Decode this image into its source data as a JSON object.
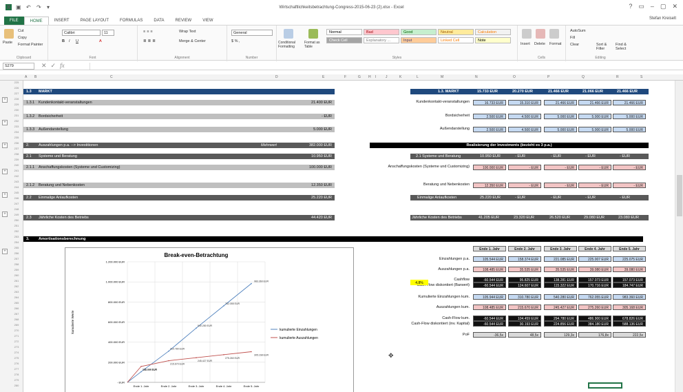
{
  "window": {
    "title": "Wirtschaftlichkeitsbetrachtung-Congress-2015-06-23 (2).xlsx - Excel",
    "user": "Stefan Kreiselt",
    "controls": [
      "?",
      "▭",
      "–",
      "▢",
      "✕"
    ]
  },
  "tabs": [
    "FILE",
    "HOME",
    "INSERT",
    "PAGE LAYOUT",
    "FORMULAS",
    "DATA",
    "REVIEW",
    "VIEW"
  ],
  "ribbon": {
    "clipboard": {
      "paste": "Paste",
      "cut": "Cut",
      "copy": "Copy",
      "painter": "Format Painter",
      "label": "Clipboard"
    },
    "font": {
      "name": "Calibri",
      "size": "11",
      "label": "Font"
    },
    "alignment": {
      "wrap": "Wrap Text",
      "merge": "Merge & Center",
      "label": "Alignment"
    },
    "number": {
      "format": "General",
      "label": "Number"
    },
    "styles": {
      "conditional": "Conditional Formatting",
      "table": "Format as Table",
      "items": [
        {
          "name": "Normal",
          "bg": "#ffffff",
          "fg": "#000000"
        },
        {
          "name": "Bad",
          "bg": "#ffc7ce",
          "fg": "#9c0006"
        },
        {
          "name": "Good",
          "bg": "#c6efce",
          "fg": "#006100"
        },
        {
          "name": "Neutral",
          "bg": "#ffeb9c",
          "fg": "#9c5700"
        },
        {
          "name": "Calculation",
          "bg": "#f2f2f2",
          "fg": "#fa7d00"
        },
        {
          "name": "Check Cell",
          "bg": "#a5a5a5",
          "fg": "#ffffff"
        },
        {
          "name": "Explanatory ...",
          "bg": "#ffffff",
          "fg": "#7f7f7f"
        },
        {
          "name": "Input",
          "bg": "#ffcc99",
          "fg": "#3f3f76"
        },
        {
          "name": "Linked Cell",
          "bg": "#ffffff",
          "fg": "#fa7d00"
        },
        {
          "name": "Note",
          "bg": "#ffffcc",
          "fg": "#000000"
        }
      ],
      "label": "Styles"
    },
    "cells": {
      "insert": "Insert",
      "delete": "Delete",
      "format": "Format",
      "label": "Cells"
    },
    "editing": {
      "autosum": "AutoSum",
      "fill": "Fill",
      "clear": "Clear",
      "sort": "Sort & Filter",
      "find": "Find & Select",
      "label": "Editing"
    }
  },
  "formula_bar": {
    "name_box": "S279",
    "fx": "fx",
    "value": ""
  },
  "columns": [
    "A",
    "B",
    "C",
    "D",
    "E",
    "F",
    "G",
    "H",
    "I",
    "J",
    "K",
    "L",
    "M",
    "N",
    "O",
    "P",
    "Q",
    "R",
    "S"
  ],
  "left_rows": [
    {
      "num": "1.3",
      "label": "MARKT",
      "value": "",
      "style": "navy"
    },
    {
      "num": "1.3.1",
      "label": "Kundenkontakt-veranstaltungen",
      "value": "21.400 EUR",
      "style": "grey"
    },
    {
      "num": "1.3.2",
      "label": "Bordsicherheit",
      "value": "- EUR",
      "style": "grey"
    },
    {
      "num": "1.3.3",
      "label": "Außendarstellung",
      "value": "5.000 EUR",
      "style": "grey"
    },
    {
      "num": "2.",
      "label": "Auszahlungen p.a. --> Investitionen",
      "value": "382.000 EUR",
      "note": "Mehrwert",
      "style": "dgrey"
    },
    {
      "num": "2.1",
      "label": "Systeme und Beratung",
      "value": "10.950 EUR",
      "style": "dgrey"
    },
    {
      "num": "2.1.1",
      "label": "Anschaffungskosten (Systeme und Customizing)",
      "value": "100.000 EUR",
      "style": "grey"
    },
    {
      "num": "2.1.2",
      "label": "Beratung und Nebenkosten",
      "value": "12.350 EUR",
      "style": "grey"
    },
    {
      "num": "2.2",
      "label": "Einmalige Anlaufkosten",
      "value": "25.220 EUR",
      "style": "dgrey"
    },
    {
      "num": "2.3",
      "label": "Jährliche Kosten des Betriebs",
      "value": "44.420 EUR",
      "style": "dgrey"
    },
    {
      "num": "3.",
      "label": "Amortisationsberechnung",
      "value": "",
      "style": "black"
    }
  ],
  "right_top": {
    "markt": {
      "label": "1.3. MARKT",
      "values": [
        "15.733 EUR",
        "20.270 EUR",
        "21.466 EUR",
        "21.066 EUR",
        "21.466 EUR"
      ]
    },
    "rows": [
      {
        "label": "Kundenkontakt-veranstaltungen",
        "values": [
          "16.733 EUR",
          "15.310 EUR",
          "21.466 EUR",
          "21.466 EUR",
          "21.466 EUR"
        ],
        "color": "blue"
      },
      {
        "label": "Bordsicherheit",
        "values": [
          "2.500 EUR",
          "4.500 EUR",
          "5.000 EUR",
          "5.000 EUR",
          "5.000 EUR"
        ],
        "color": "blue"
      },
      {
        "label": "Außendarstellung",
        "values": [
          "2.500 EUR",
          "4.500 EUR",
          "5.000 EUR",
          "5.000 EUR",
          "5.000 EUR"
        ],
        "color": "blue"
      }
    ],
    "invest_header": "Realisierung der Investments (bezieht es 3 p.a.)",
    "systeme": {
      "label": "2.1 Systeme und Beratung",
      "values": [
        "10.950 EUR",
        "- EUR",
        "- EUR",
        "- EUR",
        "- EUR"
      ]
    },
    "rows2": [
      {
        "label": "Anschaffungskosten (Systeme und Customizing)",
        "values": [
          "100.000 EUR",
          "- EUR",
          "- EUR",
          "- EUR",
          "- EUR"
        ],
        "color": "red"
      },
      {
        "label": "Beratung und Nebenkosten",
        "values": [
          "12.350 EUR",
          "- EUR",
          "- EUR",
          "- EUR",
          "- EUR"
        ],
        "color": "red"
      }
    ],
    "anlauf": {
      "label": "Einmalige Anlaufkosten",
      "values": [
        "25.220 EUR",
        "- EUR",
        "- EUR",
        "- EUR",
        "- EUR"
      ]
    },
    "betrieb": {
      "label": "Jährliche Kosten des Betriebs",
      "values": [
        "41.205 EUR",
        "23.320 EUR",
        "26.520 EUR",
        "29.080 EUR",
        "23.080 EUR"
      ]
    }
  },
  "amort": {
    "headers": [
      "Ende 1. Jahr",
      "Ende 2. Jahr",
      "Ende 3. Jahr",
      "Ende 4. Jahr",
      "Ende 5. Jahr"
    ],
    "rows": [
      {
        "label": "Einzahlungen p.a.",
        "values": [
          "105.544 EUR",
          "158.374 EUR",
          "221.085 EUR",
          "225.007 EUR",
          "225.075 EUR"
        ],
        "color": "blue"
      },
      {
        "label": "Auszahlungen p.a.",
        "values": [
          "108.485 EUR",
          "35.535 EUR",
          "35.535 EUR",
          "39.080 EUR",
          "39.080 EUR"
        ],
        "color": "red"
      },
      {
        "label": "Cashflow",
        "values": [
          "-60.544 EUR",
          "95.825 EUR",
          "138.281 EUR",
          "157.073 EUR",
          "157.073 EUR"
        ],
        "color": "black"
      },
      {
        "label": "Cash Flow diskontiert (Barwert)",
        "values": [
          "-60.544 EUR",
          "124.607 EUR",
          "115.322 EUR",
          "170.716 EUR",
          "184.747 EUR"
        ],
        "color": "black"
      },
      {
        "label": "Kumulierte Einzahlungen kum.",
        "values": [
          "105.944 EUR",
          "310.780 EUR",
          "540.280 EUR",
          "762.055 EUR",
          "983.360 EUR"
        ],
        "color": "blue"
      },
      {
        "label": "Auszahlungen kum.",
        "values": [
          "108.485 EUR",
          "215.670 EUR",
          "245.427 EUR",
          "275.260 EUR",
          "305.168 EUR"
        ],
        "color": "red"
      },
      {
        "label": "Cash-Flow kum.",
        "values": [
          "-60.544 EUR",
          "104.459 EUR",
          "294.780 EUR",
          "486.900 EUR",
          "678.826 EUR"
        ],
        "color": "black"
      },
      {
        "label": "Cash-Flow diskontiert (inv. Kapital)",
        "values": [
          "-60.544 EUR",
          "30.193 EUR",
          "224.856 EUR",
          "384.180 EUR",
          "588.136 EUR"
        ],
        "color": "black"
      },
      {
        "label": "PoF",
        "values": [
          "-36,5x",
          "48,5x",
          "129,3x",
          "176,8x",
          "222,5x"
        ],
        "color": "grey"
      }
    ],
    "rate": "4,8%"
  },
  "chart_data": {
    "type": "line",
    "title": "Break-even-Betrachtung",
    "ylabel": "kumulierte Werte",
    "categories": [
      "Ende 1. Jahr",
      "Ende 2. Jahr",
      "Ende 3. Jahr",
      "Ende 4. Jahr",
      "Ende 5. Jahr"
    ],
    "yticks": [
      "1.200.000 EUR",
      "1.000.000 EUR",
      "800.000 EUR",
      "600.000 EUR",
      "400.000 EUR",
      "200.000 EUR",
      "- EUR"
    ],
    "ylim": [
      0,
      1200000
    ],
    "series": [
      {
        "name": "kumulierte Einzahlungen",
        "color": "#4f81bd",
        "values": [
          105944,
          310780,
          540280,
          762055,
          983360
        ],
        "labels": [
          "105.944 EUR",
          "310.780 EUR",
          "540.280 EUR",
          "762.055 EUR",
          "983.360 EUR"
        ]
      },
      {
        "name": "kumulierte Auszahlungen",
        "color": "#c0504d",
        "values": [
          158485,
          215670,
          245427,
          275260,
          305168
        ],
        "labels": [
          "158.485 EUR",
          "215.670 EUR",
          "245.427 EUR",
          "275.260 EUR",
          "305.168 EUR"
        ]
      }
    ]
  }
}
